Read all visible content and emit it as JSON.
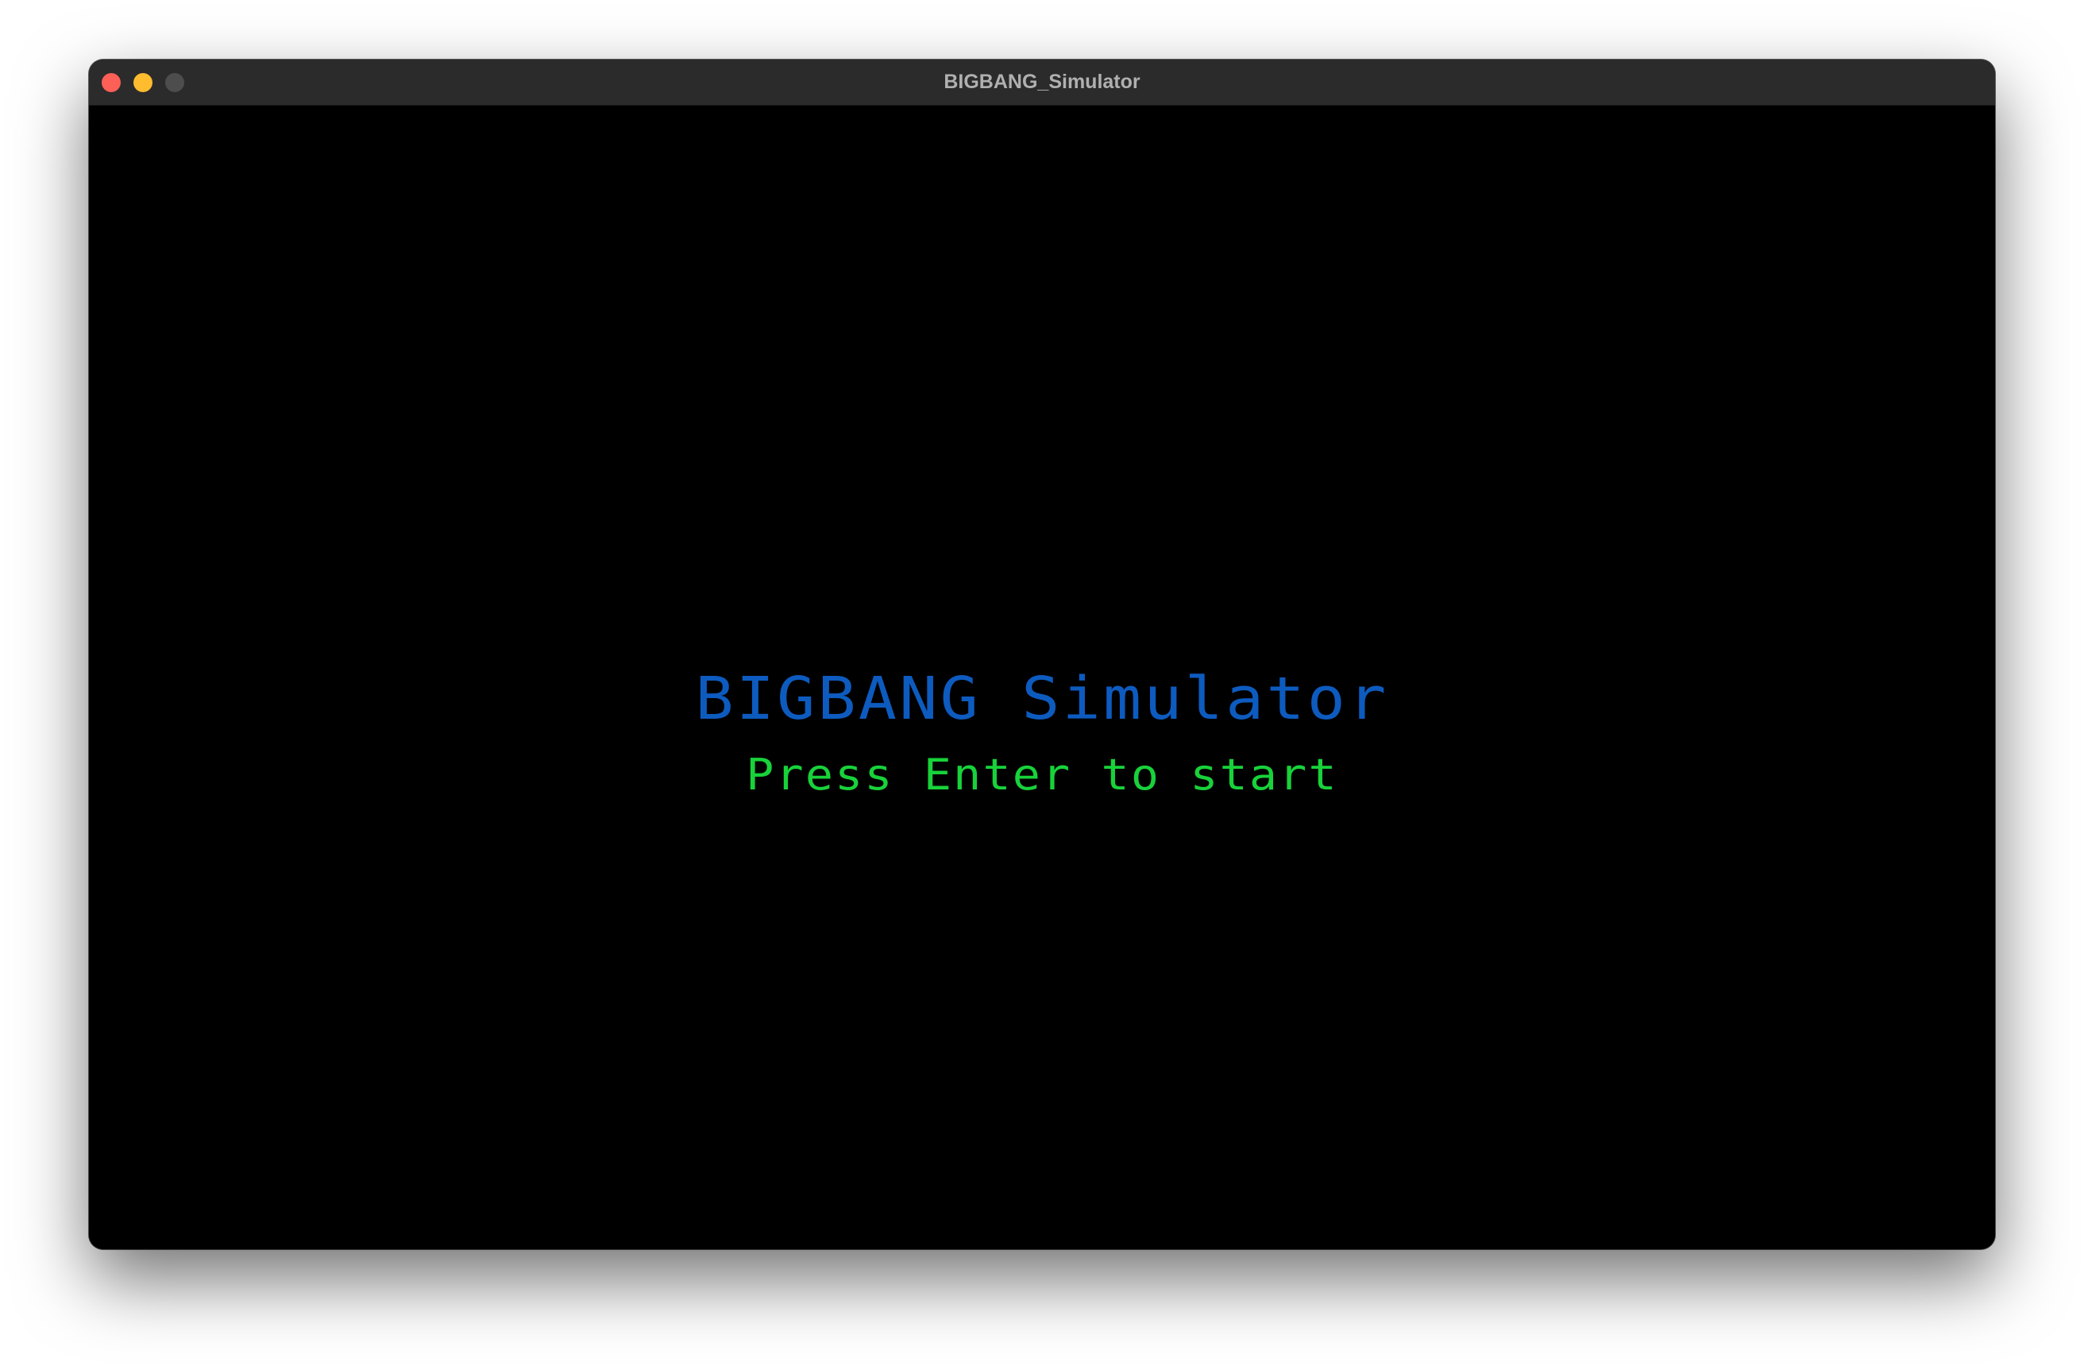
{
  "window": {
    "title": "BIGBANG_Simulator"
  },
  "game": {
    "title": "BIGBANG Simulator",
    "prompt": "Press Enter to start",
    "colors": {
      "title": "#0d5bbf",
      "prompt": "#18d23a",
      "background": "#000000"
    }
  }
}
